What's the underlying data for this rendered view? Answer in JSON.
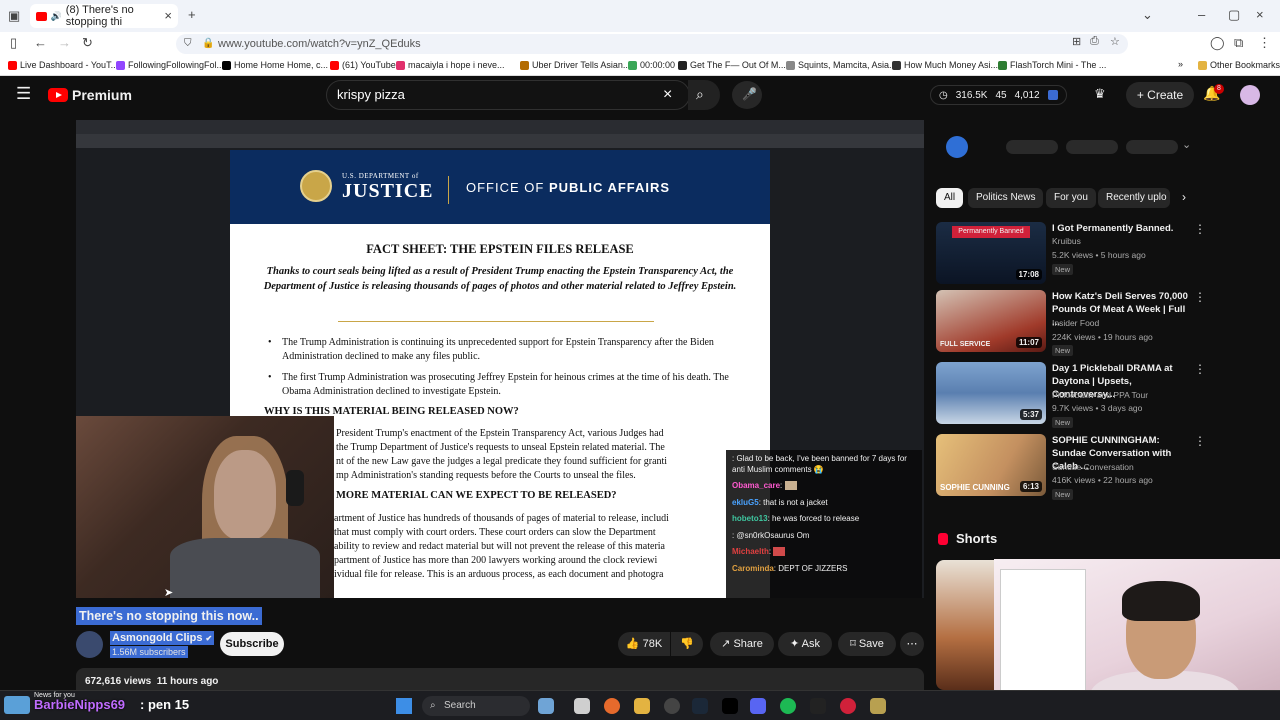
{
  "browser": {
    "tab_title": "(8) There's no stopping thi",
    "url": "www.youtube.com/watch?v=ynZ_QEduks",
    "bookmarks": [
      {
        "label": "Live Dashboard - YouT...",
        "color": "#ff0000"
      },
      {
        "label": "FollowingFollowingFol...",
        "color": "#9146ff"
      },
      {
        "label": "Home Home Home, c...",
        "color": "#000000"
      },
      {
        "label": "(61) YouTube",
        "color": "#ff0000"
      },
      {
        "label": "macaiyla i hope i neve...",
        "color": "#e1306c"
      },
      {
        "label": "Uber Driver Tells Asian...",
        "color": "#b36b00"
      },
      {
        "label": "00:00:00",
        "color": "#3aa757"
      },
      {
        "label": "Get The F— Out Of M...",
        "color": "#222222"
      },
      {
        "label": "Squints, Mamcita, Asia...",
        "color": "#888888"
      },
      {
        "label": "How Much Money Asi...",
        "color": "#333333"
      },
      {
        "label": "FlashTorch Mini - The ...",
        "color": "#2e7d32"
      }
    ],
    "other_bookmarks": "Other Bookmarks"
  },
  "header": {
    "brand": "Premium",
    "search_query": "krispy pizza",
    "stats": [
      "316.5K",
      "45",
      "4,012"
    ],
    "create_label": "Create",
    "notification_count": "8"
  },
  "video": {
    "doc": {
      "dept": "U.S. DEPARTMENT of",
      "justice": "JUSTICE",
      "office_pre": "OFFICE OF ",
      "office_bold": "PUBLIC AFFAIRS",
      "title": "FACT SHEET: THE EPSTEIN FILES RELEASE",
      "subtitle": "Thanks to court seals being lifted as a result of President Trump enacting the Epstein Transparency Act, the Department of Justice is releasing thousands of pages of photos and other material related to Jeffrey Epstein.",
      "bullet1": "The Trump Administration is continuing its unprecedented support for Epstein Transparency after the Biden Administration declined to make any files public.",
      "bullet2": "The first Trump Administration was prosecuting Jeffrey Epstein for heinous crimes at the time of his death. The Obama Administration declined to investigate Epstein.",
      "why_heading": "WHY IS THIS MATERIAL BEING RELEASED NOW?",
      "why_lines": [
        "President Trump's enactment of the Epstein Transparency Act, various Judges had",
        "the Trump Department of Justice's requests to unseal Epstein related material. The",
        "nt of the new Law gave the judges a legal predicate they found sufficient for granti",
        "mp Administration's standing requests before the Courts to unseal the files."
      ],
      "more_heading": "MORE MATERIAL CAN WE EXPECT TO BE RELEASED?",
      "more_lines": [
        "artment of Justice has hundreds of thousands of pages of material to release, includi",
        "that must comply with court orders. These court orders can slow the Department",
        "ability to review and redact material but will not prevent the release of this materia",
        "partment of Justice has more than 200 lawyers working around the clock reviewi",
        "ividual file for release. This is an arduous process, as each document and photogra"
      ]
    },
    "chat": [
      {
        "user": "",
        "text": ": Glad to be back, I've been banned for 7 days for anti Muslim comments 😭",
        "color": "#e04040"
      },
      {
        "user": "Obama_care",
        "text": ":",
        "color": "#ff5ad0"
      },
      {
        "user": "ekluG5",
        "text": ": that is not a jacket",
        "color": "#4aa3ff"
      },
      {
        "user": "hobeto13",
        "text": ": he was forced to release",
        "color": "#3fc7a0"
      },
      {
        "user": "",
        "text": ": @sn0rkOsaurus Om",
        "color": "#e04040"
      },
      {
        "user": "Michaelth",
        "text": ":",
        "color": "#e04040"
      },
      {
        "user": "Carominda",
        "text": ": DEPT OF JIZZERS",
        "color": "#e0a040"
      }
    ]
  },
  "meta": {
    "title": "There's no stopping this now..",
    "channel": "Asmongold Clips",
    "subscribers": "1.56M subscribers",
    "subscribe_label": "Subscribe",
    "likes": "78K",
    "share_label": "Share",
    "ask_label": "Ask",
    "save_label": "Save",
    "views": "672,616 views",
    "age": "11 hours ago"
  },
  "sidebar": {
    "chips": [
      "All",
      "Politics News",
      "For you",
      "Recently uplo"
    ],
    "recs": [
      {
        "title": "I Got Permanently Banned.",
        "channel": "Kruibus",
        "views": "5.2K views • 5 hours ago",
        "duration": "17:08",
        "badge": "New",
        "thumb_label": "Permanently Banned",
        "colors": [
          "#1b2c44",
          "#d0213a"
        ]
      },
      {
        "title": "How Katz's Deli Serves 70,000 Pounds Of Meat A Week | Full ...",
        "channel": "Insider Food",
        "views": "224K views • 19 hours ago",
        "duration": "11:07",
        "badge": "New",
        "thumb_label": "FULL SERVICE",
        "colors": [
          "#d4c2b4",
          "#a03a2a"
        ]
      },
      {
        "title": "Day 1 Pickleball DRAMA at Daytona | Upsets, Controversy...",
        "channel": "Pickleballtv and PPA Tour",
        "views": "9.7K views • 3 days ago",
        "duration": "5:37",
        "badge": "New",
        "thumb_label": "",
        "colors": [
          "#5a7fb0",
          "#c8d6e5"
        ]
      },
      {
        "title": "SOPHIE CUNNINGHAM: Sundae Conversation with Caleb ...",
        "channel": "Sundae Conversation",
        "views": "416K views • 22 hours ago",
        "duration": "6:13",
        "badge": "New",
        "thumb_label": "SOPHIE CUNNING",
        "colors": [
          "#e6c07a",
          "#7a5a3a"
        ]
      }
    ],
    "shorts_heading": "Shorts"
  },
  "taskbar": {
    "search": "Search",
    "overlay_small": "News for you",
    "overlay_name": "BarbieNipps69",
    "overlay_text": ": pen 15"
  }
}
